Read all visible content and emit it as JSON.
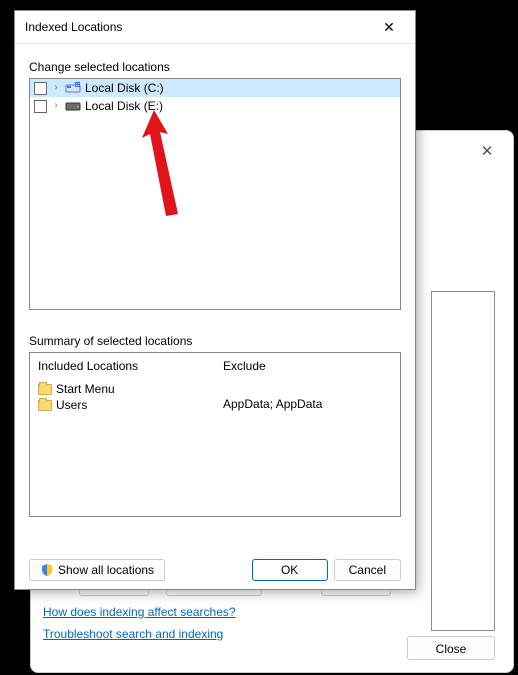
{
  "dialog": {
    "title": "Indexed Locations",
    "change_label": "Change selected locations",
    "tree": [
      {
        "label": "Local Disk (C:)",
        "drive_type": "system",
        "selected": true
      },
      {
        "label": "Local Disk (E:)",
        "drive_type": "hdd",
        "selected": false
      }
    ],
    "summary_label": "Summary of selected locations",
    "included_header": "Included Locations",
    "exclude_header": "Exclude",
    "included": [
      "Start Menu",
      "Users"
    ],
    "excluded_text": "AppData; AppData",
    "show_all": "Show all locations",
    "ok": "OK",
    "cancel": "Cancel"
  },
  "bg": {
    "link1": "How does indexing affect searches?",
    "link2": "Troubleshoot search and indexing",
    "close": "Close"
  }
}
